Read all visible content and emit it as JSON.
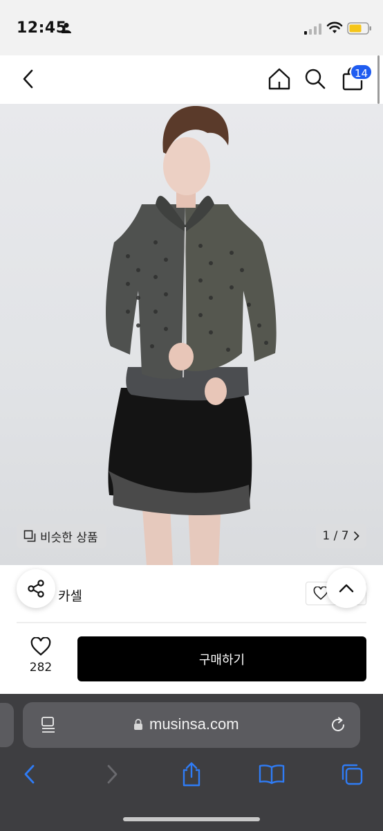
{
  "status_bar": {
    "time": "12:45"
  },
  "header": {
    "cart_count": "14"
  },
  "hero": {
    "similar_label": "비슷한 상품",
    "counter": "1 / 7"
  },
  "brand": {
    "name": "카셀"
  },
  "purchase": {
    "like_count": "282",
    "buy_label": "구매하기"
  },
  "browser": {
    "url": "musinsa.com"
  },
  "colors": {
    "accent": "#1f5cf0",
    "buy_button": "#000000",
    "browser_bar": "#3e3e41"
  }
}
